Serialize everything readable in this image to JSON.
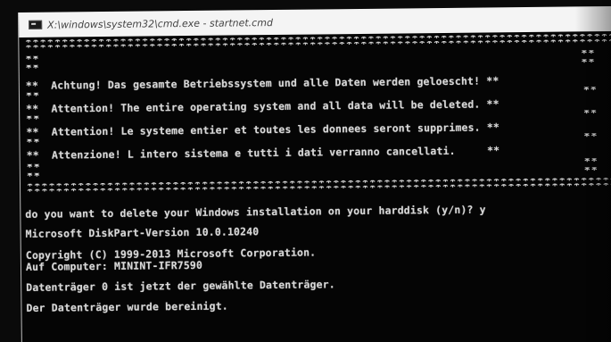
{
  "window": {
    "title": "X:\\windows\\system32\\cmd.exe - startnet.cmd",
    "icon": "cmd-icon"
  },
  "console": {
    "border_line": "***********************************************************************************",
    "side_marker": "**",
    "warnings": [
      "Achtung! Das gesamte Betriebssystem und alle Daten werden geloescht!",
      "Attention! The entire operating system and all data will be deleted.",
      "Attention! Le systeme entier et toutes les donnees seront supprimes.",
      "Attenzione! L intero sistema e tutti i dati verranno cancellati."
    ],
    "prompt": "do you want to delete your Windows installation on your harddisk (y/n)? y",
    "output": [
      "Microsoft DiskPart-Version 10.0.10240",
      "Copyright (C) 1999-2013 Microsoft Corporation.",
      "Auf Computer: MININT-IFR7590",
      "Datenträger 0 ist jetzt der gewählte Datenträger.",
      "Der Datenträger wurde bereinigt."
    ]
  }
}
